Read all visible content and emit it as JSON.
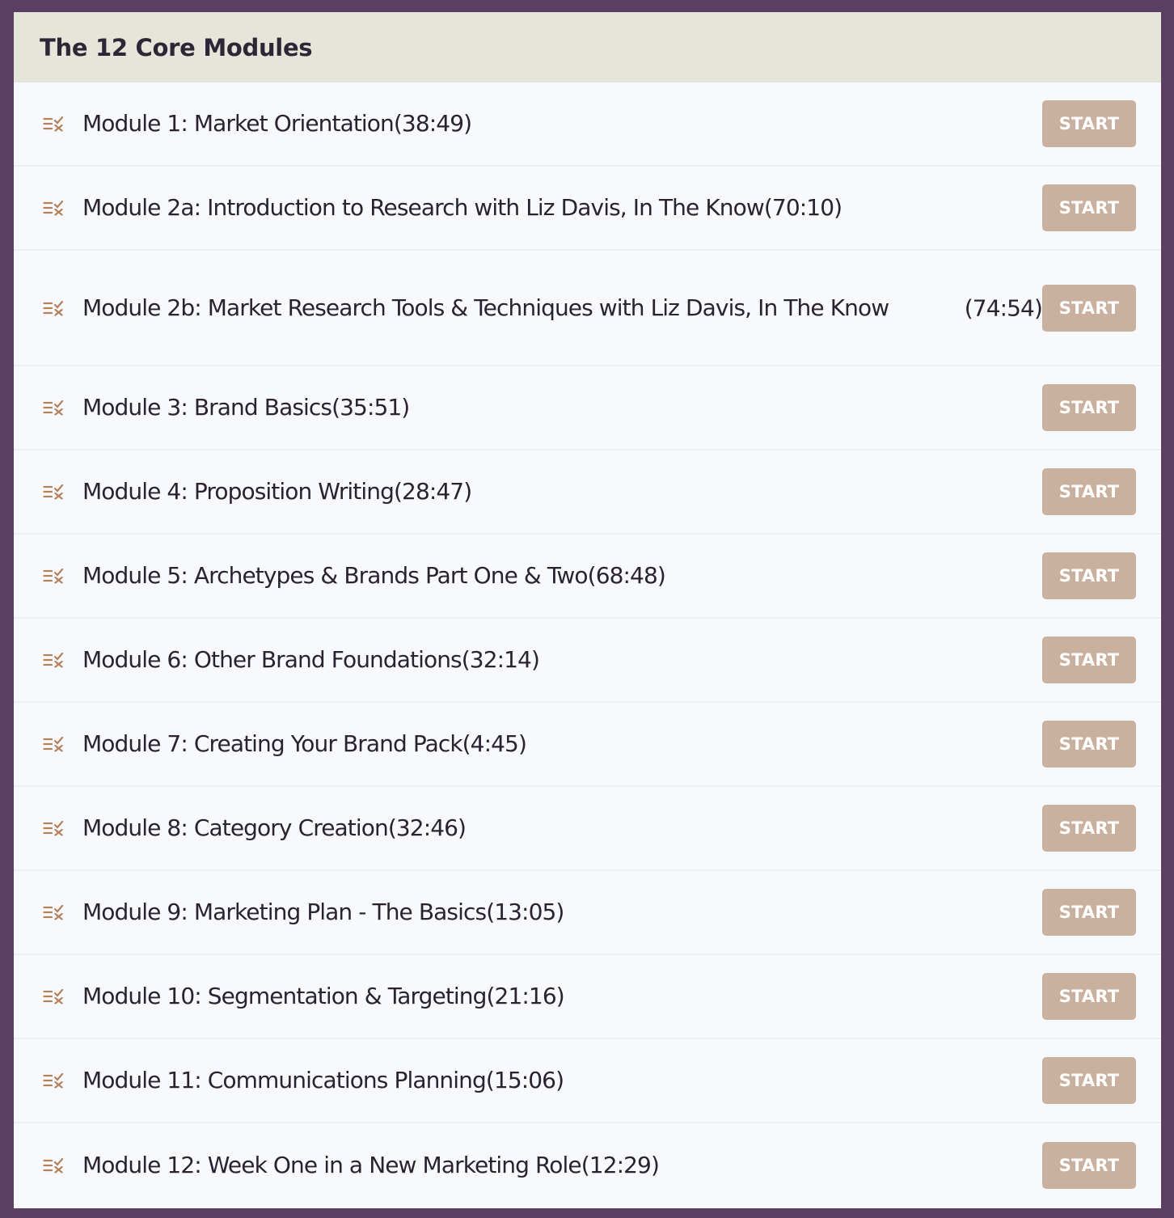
{
  "section": {
    "title": "The 12 Core Modules"
  },
  "colors": {
    "frame": "#5a3f63",
    "header_bg": "#e6e5d9",
    "list_bg": "#f8f9fd",
    "button_bg": "#c9b09f",
    "icon": "#b5805a"
  },
  "modules": [
    {
      "title": "Module 1: Market Orientation",
      "duration": "(38:49)",
      "button_label": "START",
      "icon": "list-check-icon"
    },
    {
      "title": "Module 2a: Introduction to Research with Liz Davis, In The Know",
      "duration": "(70:10)",
      "button_label": "START",
      "icon": "list-check-icon"
    },
    {
      "title": "Module 2b: Market Research Tools & Techniques with Liz Davis, In The Know",
      "duration": "(74:54)",
      "button_label": "START",
      "icon": "list-check-icon"
    },
    {
      "title": "Module 3: Brand Basics",
      "duration": "(35:51)",
      "button_label": "START",
      "icon": "list-check-icon"
    },
    {
      "title": "Module 4: Proposition Writing",
      "duration": "(28:47)",
      "button_label": "START",
      "icon": "list-check-icon"
    },
    {
      "title": "Module 5: Archetypes & Brands Part One & Two",
      "duration": "(68:48)",
      "button_label": "START",
      "icon": "list-check-icon"
    },
    {
      "title": "Module 6: Other Brand Foundations",
      "duration": "(32:14)",
      "button_label": "START",
      "icon": "list-check-icon"
    },
    {
      "title": "Module 7: Creating Your Brand Pack",
      "duration": "(4:45)",
      "button_label": "START",
      "icon": "list-check-icon"
    },
    {
      "title": "Module 8: Category Creation",
      "duration": "(32:46)",
      "button_label": "START",
      "icon": "list-check-icon"
    },
    {
      "title": "Module 9: Marketing Plan - The Basics",
      "duration": "(13:05)",
      "button_label": "START",
      "icon": "list-check-icon"
    },
    {
      "title": "Module 10: Segmentation & Targeting",
      "duration": "(21:16)",
      "button_label": "START",
      "icon": "list-check-icon"
    },
    {
      "title": "Module 11: Communications Planning",
      "duration": "(15:06)",
      "button_label": "START",
      "icon": "list-check-icon"
    },
    {
      "title": "Module 12: Week One in a New Marketing Role",
      "duration": "(12:29)",
      "button_label": "START",
      "icon": "list-check-icon"
    }
  ]
}
